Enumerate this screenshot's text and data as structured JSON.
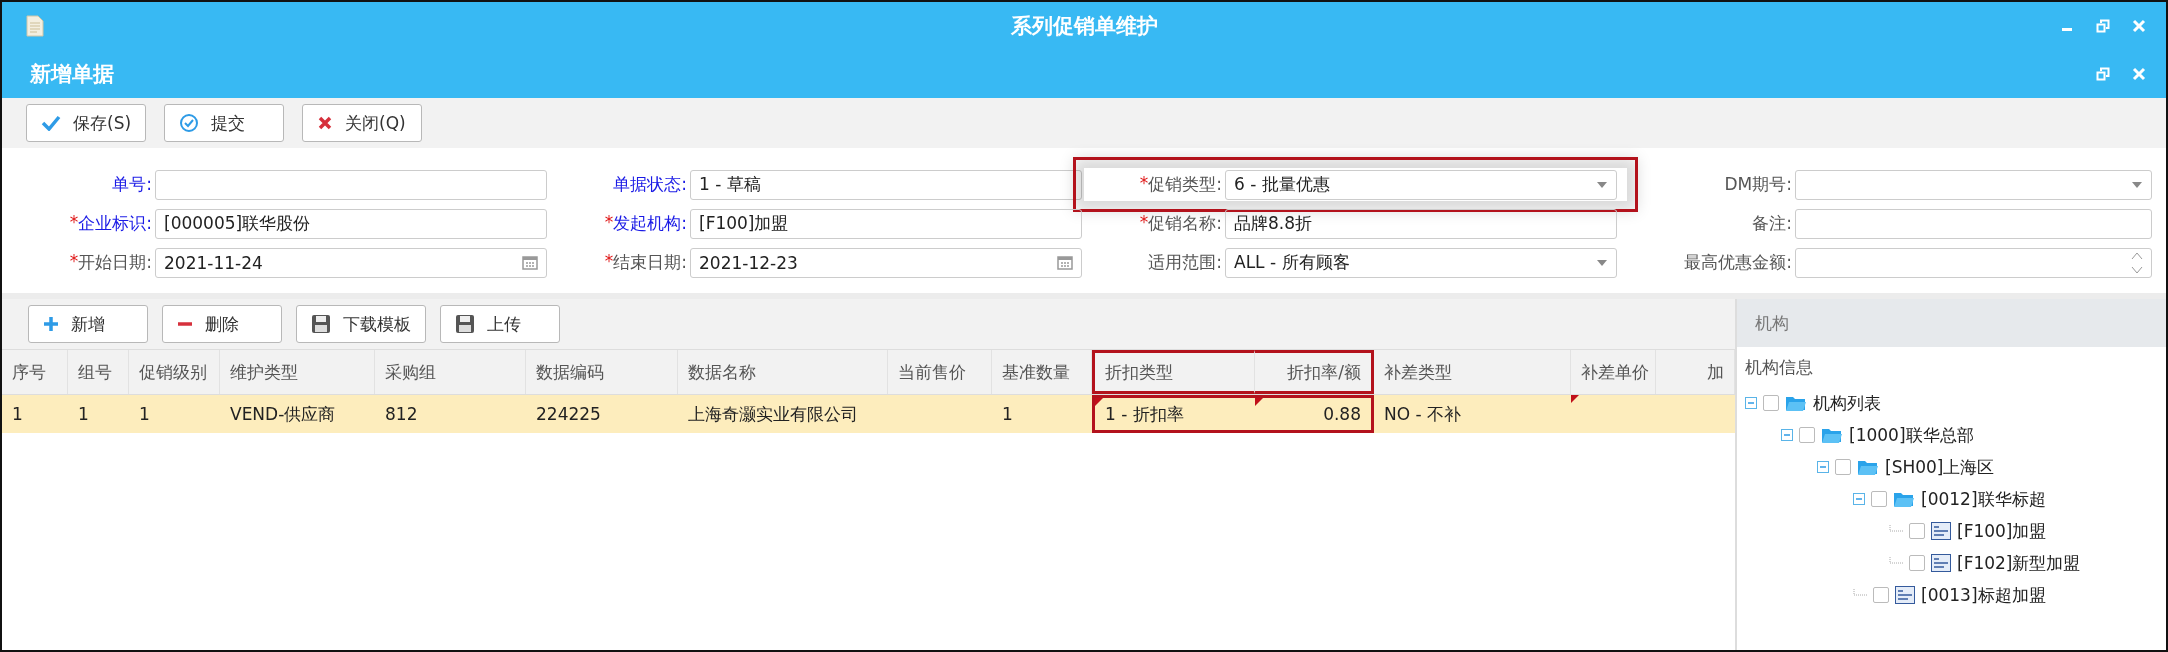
{
  "window": {
    "title": "系列促销单维护"
  },
  "subwindow": {
    "title": "新增单据"
  },
  "toolbar": [
    {
      "label": "保存(S)"
    },
    {
      "label": "提交"
    },
    {
      "label": "关闭(Q)"
    }
  ],
  "form": [
    {
      "label": "单号:",
      "link": true,
      "kind": "text"
    },
    {
      "label": "单据状态:",
      "link": true,
      "kind": "text",
      "value": "1 - 草稿"
    },
    {
      "mark": "*",
      "label": "促销类型:",
      "link": false,
      "kind": "select",
      "value": "6 - 批量优惠",
      "highlight": true
    },
    {
      "label": "DM期号:",
      "link": false,
      "kind": "select"
    },
    {
      "mark": "*",
      "label": "企业标识:",
      "link": true,
      "kind": "text",
      "value": "[000005]联华股份"
    },
    {
      "mark": "*",
      "label": "发起机构:",
      "link": true,
      "kind": "text",
      "value": "[F100]加盟"
    },
    {
      "mark": "*",
      "label": "促销名称:",
      "link": false,
      "kind": "text",
      "value": "品牌8.8折"
    },
    {
      "label": "备注:",
      "link": false,
      "kind": "text"
    },
    {
      "mark": "*",
      "label": "开始日期:",
      "link": false,
      "kind": "date",
      "value": "2021-11-24"
    },
    {
      "mark": "*",
      "label": "结束日期:",
      "link": false,
      "kind": "date",
      "value": "2021-12-23"
    },
    {
      "label": "适用范围:",
      "link": false,
      "kind": "select",
      "value": "ALL - 所有顾客"
    },
    {
      "label": "最高优惠金额:",
      "link": false,
      "kind": "spinner"
    }
  ],
  "grid_toolbar": [
    {
      "label": "新增"
    },
    {
      "label": "删除"
    },
    {
      "label": "下载模板"
    },
    {
      "label": "上传"
    }
  ],
  "table": {
    "columns": [
      {
        "label": "序号"
      },
      {
        "label": "组号"
      },
      {
        "label": "促销级别"
      },
      {
        "label": "维护类型"
      },
      {
        "label": "采购组"
      },
      {
        "label": "数据编码"
      },
      {
        "label": "数据名称"
      },
      {
        "label": "当前售价"
      },
      {
        "label": "基准数量"
      },
      {
        "label": "折扣类型",
        "highlight": true,
        "editable": true
      },
      {
        "label": "折扣率/额",
        "highlight": true,
        "editable": true
      },
      {
        "label": "补差类型"
      },
      {
        "label": "补差单价",
        "editable": true
      },
      {
        "label": "加"
      }
    ],
    "rows": [
      {
        "selected": true,
        "cells": [
          "1",
          "1",
          "1",
          "VEND-供应商",
          "812",
          "224225",
          "上海奇灏实业有限公司",
          null,
          "1",
          "1 - 折扣率",
          "0.88",
          "NO - 不补",
          null,
          null
        ]
      }
    ]
  },
  "side_panel": {
    "title": "机构",
    "subtitle": "机构信息",
    "tree": [
      {
        "label": "机构列表",
        "kind": "folder",
        "expanded": true,
        "checked": false,
        "children": [
          {
            "label": "[1000]联华总部",
            "kind": "folder",
            "expanded": true,
            "checked": false,
            "children": [
              {
                "label": "[SH00]上海区",
                "kind": "folder",
                "expanded": true,
                "checked": false,
                "children": [
                  {
                    "label": "[0012]联华标超",
                    "kind": "folder",
                    "expanded": true,
                    "checked": false,
                    "children": [
                      {
                        "label": "[F100]加盟",
                        "kind": "org",
                        "checked": false
                      },
                      {
                        "label": "[F102]新型加盟",
                        "kind": "org",
                        "checked": false
                      }
                    ]
                  },
                  {
                    "label": "[0013]标超加盟",
                    "kind": "org",
                    "checked": false
                  }
                ]
              }
            ]
          }
        ]
      }
    ]
  }
}
